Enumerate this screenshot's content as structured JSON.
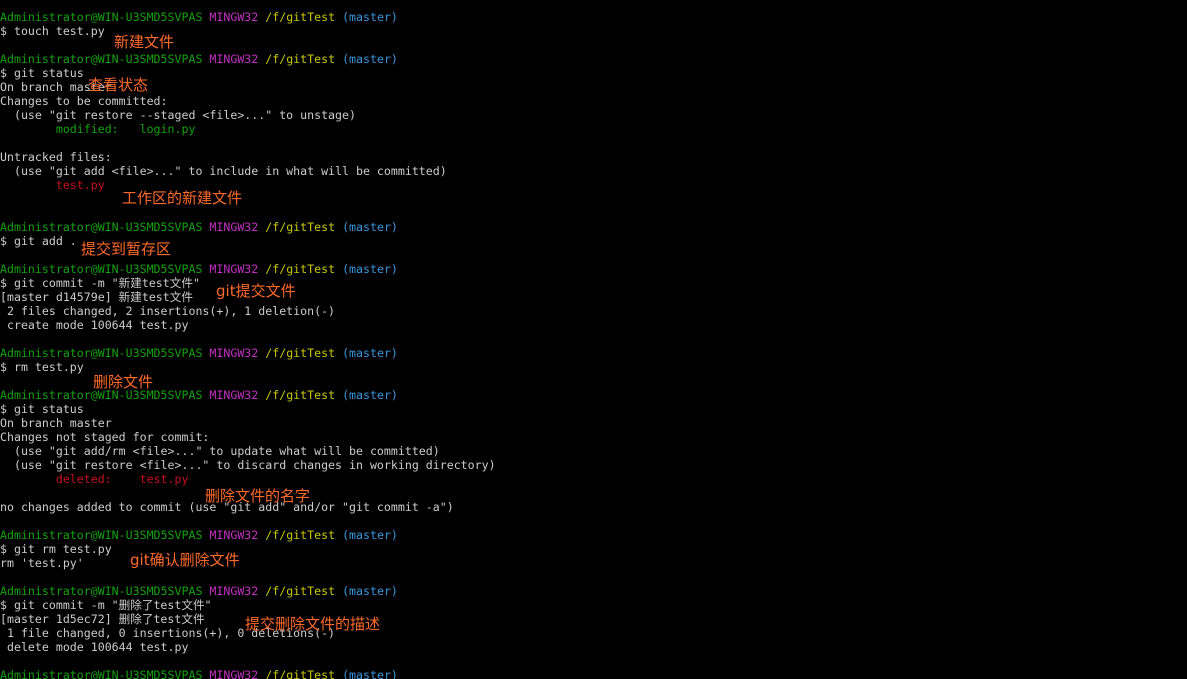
{
  "prompt": {
    "user": "Administrator@WIN-U3SMD5SVPAS",
    "system": "MINGW32",
    "path": "/f/gitTest",
    "branch": "(master)"
  },
  "lines": [
    {
      "kind": "prompt"
    },
    {
      "kind": "text",
      "text": "$ touch test.py"
    },
    {
      "kind": "blank"
    },
    {
      "kind": "prompt"
    },
    {
      "kind": "text",
      "text": "$ git status"
    },
    {
      "kind": "text",
      "text": "On branch master"
    },
    {
      "kind": "text",
      "text": "Changes to be committed:"
    },
    {
      "kind": "text",
      "text": "  (use \"git restore --staged <file>...\" to unstage)"
    },
    {
      "kind": "colored",
      "color": "green",
      "text": "        modified:   login.py"
    },
    {
      "kind": "blank"
    },
    {
      "kind": "text",
      "text": "Untracked files:"
    },
    {
      "kind": "text",
      "text": "  (use \"git add <file>...\" to include in what will be committed)"
    },
    {
      "kind": "colored",
      "color": "red",
      "text": "        test.py"
    },
    {
      "kind": "blank"
    },
    {
      "kind": "blank"
    },
    {
      "kind": "prompt"
    },
    {
      "kind": "text",
      "text": "$ git add ."
    },
    {
      "kind": "blank"
    },
    {
      "kind": "prompt"
    },
    {
      "kind": "text",
      "text": "$ git commit -m \"新建test文件\""
    },
    {
      "kind": "text",
      "text": "[master d14579e] 新建test文件"
    },
    {
      "kind": "text",
      "text": " 2 files changed, 2 insertions(+), 1 deletion(-)"
    },
    {
      "kind": "text",
      "text": " create mode 100644 test.py"
    },
    {
      "kind": "blank"
    },
    {
      "kind": "prompt"
    },
    {
      "kind": "text",
      "text": "$ rm test.py"
    },
    {
      "kind": "blank"
    },
    {
      "kind": "prompt"
    },
    {
      "kind": "text",
      "text": "$ git status"
    },
    {
      "kind": "text",
      "text": "On branch master"
    },
    {
      "kind": "text",
      "text": "Changes not staged for commit:"
    },
    {
      "kind": "text",
      "text": "  (use \"git add/rm <file>...\" to update what will be committed)"
    },
    {
      "kind": "text",
      "text": "  (use \"git restore <file>...\" to discard changes in working directory)"
    },
    {
      "kind": "colored",
      "color": "red",
      "text": "        deleted:    test.py"
    },
    {
      "kind": "blank"
    },
    {
      "kind": "text",
      "text": "no changes added to commit (use \"git add\" and/or \"git commit -a\")"
    },
    {
      "kind": "blank"
    },
    {
      "kind": "prompt"
    },
    {
      "kind": "text",
      "text": "$ git rm test.py"
    },
    {
      "kind": "text",
      "text": "rm 'test.py'"
    },
    {
      "kind": "blank"
    },
    {
      "kind": "prompt"
    },
    {
      "kind": "text",
      "text": "$ git commit -m \"删除了test文件\""
    },
    {
      "kind": "text",
      "text": "[master 1d5ec72] 删除了test文件"
    },
    {
      "kind": "text",
      "text": " 1 file changed, 0 insertions(+), 0 deletions(-)"
    },
    {
      "kind": "text",
      "text": " delete mode 100644 test.py"
    },
    {
      "kind": "blank"
    },
    {
      "kind": "prompt"
    }
  ],
  "annotations": [
    {
      "text": "新建文件"
    },
    {
      "text": "查看状态"
    },
    {
      "text": "工作区的新建文件"
    },
    {
      "text": "提交到暂存区"
    },
    {
      "text": "git提交文件"
    },
    {
      "text": "删除文件"
    },
    {
      "text": "删除文件的名字"
    },
    {
      "text": "git确认删除文件"
    },
    {
      "text": "提交删除文件的描述"
    }
  ],
  "colors": {
    "background": "#000000",
    "text": "#cccccc",
    "user": "#13a10e",
    "system": "#c430c4",
    "path": "#c8c800",
    "branch": "#3a96dd",
    "modified": "#13a10e",
    "untracked": "#c50f1f",
    "annotation": "#ff6a2a"
  }
}
